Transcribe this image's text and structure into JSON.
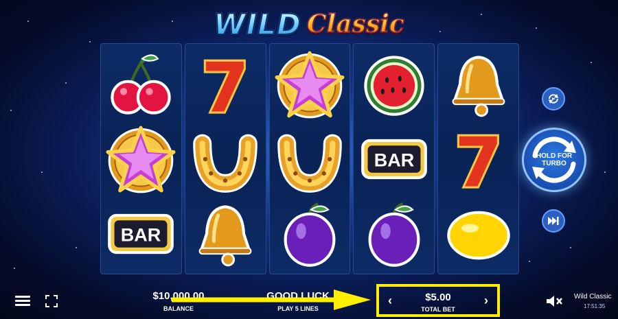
{
  "game": {
    "title_word1": "WILD",
    "title_word2": "Classic",
    "name": "Wild Classic",
    "clock": "17:51:35"
  },
  "reels": [
    [
      "cherry-icon",
      "star-icon",
      "bar-icon"
    ],
    [
      "seven-icon",
      "horseshoe-icon",
      "bell-icon"
    ],
    [
      "star-icon",
      "horseshoe-icon",
      "plum-icon"
    ],
    [
      "watermelon-icon",
      "bar-icon",
      "plum-icon"
    ],
    [
      "bell-icon",
      "seven-icon",
      "lemon-icon"
    ]
  ],
  "symbol_text": {
    "bar": "BAR",
    "seven": "7"
  },
  "controls": {
    "spin_label": "HOLD FOR TURBO"
  },
  "status": {
    "balance_value": "$10,000.00",
    "balance_label": "BALANCE",
    "win_message": "GOOD LUCK",
    "win_label": "PLAY 5 LINES",
    "bet_value": "$5.00",
    "bet_label": "TOTAL BET",
    "bet_decrease": "‹",
    "bet_increase": "›"
  },
  "colors": {
    "highlight": "#ffee00",
    "button_blue": "#1c55b8",
    "reel_bg": "#0a2356"
  }
}
